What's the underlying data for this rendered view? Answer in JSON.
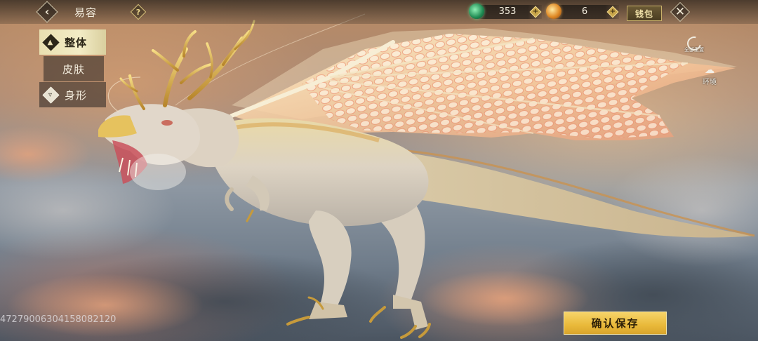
{
  "header": {
    "back_icon": "chevron-left-icon",
    "title": "易容",
    "help_icon": "question-icon"
  },
  "currencies": [
    {
      "icon": "jade-currency-icon",
      "value": "353",
      "add_icon": "plus-icon"
    },
    {
      "icon": "gold-currency-icon",
      "value": "6",
      "add_icon": "plus-icon"
    }
  ],
  "wallet_label": "钱包",
  "close_icon": "close-icon",
  "tabs": [
    {
      "label": "整体",
      "icon": "whole-body-icon",
      "selected": true
    },
    {
      "label": "皮肤",
      "selected": false
    },
    {
      "label": "身形",
      "icon": "body-shape-icon",
      "selected": false
    }
  ],
  "side_buttons": {
    "reset_all_label": "全部重置",
    "environment_label": "环境"
  },
  "save_label": "确认保存",
  "uid": "4727900630415808212​0",
  "colors": {
    "accent_gold": "#e9b93a",
    "tab_selected": "#f3ecc6",
    "jade": "#1f8a52"
  }
}
